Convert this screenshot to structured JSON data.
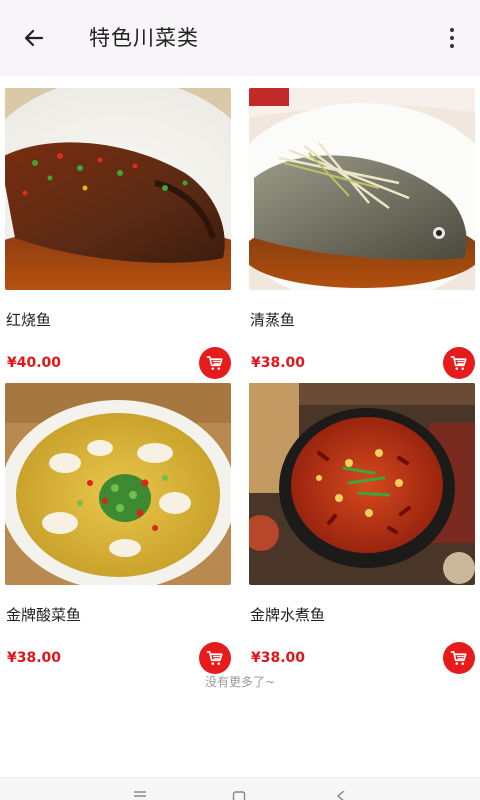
{
  "header": {
    "title": "特色川菜类",
    "back_icon": "arrow-left-icon",
    "more_icon": "more-vertical-icon"
  },
  "products": [
    {
      "name": "红烧鱼",
      "price": "¥40.00",
      "image": "braised-fish-photo"
    },
    {
      "name": "清蒸鱼",
      "price": "¥38.00",
      "image": "steamed-fish-photo"
    },
    {
      "name": "金牌酸菜鱼",
      "price": "¥38.00",
      "image": "sauerkraut-fish-photo"
    },
    {
      "name": "金牌水煮鱼",
      "price": "¥38.00",
      "image": "boiled-fish-photo"
    }
  ],
  "footer_note": "没有更多了~",
  "colors": {
    "accent": "#e61c1c",
    "price": "#e4141b",
    "header_bg": "#f7f5f7"
  },
  "system_nav": [
    "menu-icon",
    "home-icon",
    "back-icon"
  ]
}
